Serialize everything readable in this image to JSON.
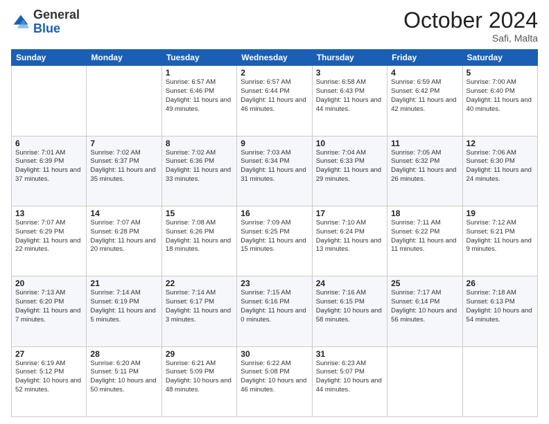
{
  "logo": {
    "general": "General",
    "blue": "Blue"
  },
  "header": {
    "month": "October 2024",
    "location": "Safi, Malta"
  },
  "days_of_week": [
    "Sunday",
    "Monday",
    "Tuesday",
    "Wednesday",
    "Thursday",
    "Friday",
    "Saturday"
  ],
  "weeks": [
    [
      {
        "day": "",
        "info": ""
      },
      {
        "day": "",
        "info": ""
      },
      {
        "day": "1",
        "info": "Sunrise: 6:57 AM\nSunset: 6:46 PM\nDaylight: 11 hours and 49 minutes."
      },
      {
        "day": "2",
        "info": "Sunrise: 6:57 AM\nSunset: 6:44 PM\nDaylight: 11 hours and 46 minutes."
      },
      {
        "day": "3",
        "info": "Sunrise: 6:58 AM\nSunset: 6:43 PM\nDaylight: 11 hours and 44 minutes."
      },
      {
        "day": "4",
        "info": "Sunrise: 6:59 AM\nSunset: 6:42 PM\nDaylight: 11 hours and 42 minutes."
      },
      {
        "day": "5",
        "info": "Sunrise: 7:00 AM\nSunset: 6:40 PM\nDaylight: 11 hours and 40 minutes."
      }
    ],
    [
      {
        "day": "6",
        "info": "Sunrise: 7:01 AM\nSunset: 6:39 PM\nDaylight: 11 hours and 37 minutes."
      },
      {
        "day": "7",
        "info": "Sunrise: 7:02 AM\nSunset: 6:37 PM\nDaylight: 11 hours and 35 minutes."
      },
      {
        "day": "8",
        "info": "Sunrise: 7:02 AM\nSunset: 6:36 PM\nDaylight: 11 hours and 33 minutes."
      },
      {
        "day": "9",
        "info": "Sunrise: 7:03 AM\nSunset: 6:34 PM\nDaylight: 11 hours and 31 minutes."
      },
      {
        "day": "10",
        "info": "Sunrise: 7:04 AM\nSunset: 6:33 PM\nDaylight: 11 hours and 29 minutes."
      },
      {
        "day": "11",
        "info": "Sunrise: 7:05 AM\nSunset: 6:32 PM\nDaylight: 11 hours and 26 minutes."
      },
      {
        "day": "12",
        "info": "Sunrise: 7:06 AM\nSunset: 6:30 PM\nDaylight: 11 hours and 24 minutes."
      }
    ],
    [
      {
        "day": "13",
        "info": "Sunrise: 7:07 AM\nSunset: 6:29 PM\nDaylight: 11 hours and 22 minutes."
      },
      {
        "day": "14",
        "info": "Sunrise: 7:07 AM\nSunset: 6:28 PM\nDaylight: 11 hours and 20 minutes."
      },
      {
        "day": "15",
        "info": "Sunrise: 7:08 AM\nSunset: 6:26 PM\nDaylight: 11 hours and 18 minutes."
      },
      {
        "day": "16",
        "info": "Sunrise: 7:09 AM\nSunset: 6:25 PM\nDaylight: 11 hours and 15 minutes."
      },
      {
        "day": "17",
        "info": "Sunrise: 7:10 AM\nSunset: 6:24 PM\nDaylight: 11 hours and 13 minutes."
      },
      {
        "day": "18",
        "info": "Sunrise: 7:11 AM\nSunset: 6:22 PM\nDaylight: 11 hours and 11 minutes."
      },
      {
        "day": "19",
        "info": "Sunrise: 7:12 AM\nSunset: 6:21 PM\nDaylight: 11 hours and 9 minutes."
      }
    ],
    [
      {
        "day": "20",
        "info": "Sunrise: 7:13 AM\nSunset: 6:20 PM\nDaylight: 11 hours and 7 minutes."
      },
      {
        "day": "21",
        "info": "Sunrise: 7:14 AM\nSunset: 6:19 PM\nDaylight: 11 hours and 5 minutes."
      },
      {
        "day": "22",
        "info": "Sunrise: 7:14 AM\nSunset: 6:17 PM\nDaylight: 11 hours and 3 minutes."
      },
      {
        "day": "23",
        "info": "Sunrise: 7:15 AM\nSunset: 6:16 PM\nDaylight: 11 hours and 0 minutes."
      },
      {
        "day": "24",
        "info": "Sunrise: 7:16 AM\nSunset: 6:15 PM\nDaylight: 10 hours and 58 minutes."
      },
      {
        "day": "25",
        "info": "Sunrise: 7:17 AM\nSunset: 6:14 PM\nDaylight: 10 hours and 56 minutes."
      },
      {
        "day": "26",
        "info": "Sunrise: 7:18 AM\nSunset: 6:13 PM\nDaylight: 10 hours and 54 minutes."
      }
    ],
    [
      {
        "day": "27",
        "info": "Sunrise: 6:19 AM\nSunset: 5:12 PM\nDaylight: 10 hours and 52 minutes."
      },
      {
        "day": "28",
        "info": "Sunrise: 6:20 AM\nSunset: 5:11 PM\nDaylight: 10 hours and 50 minutes."
      },
      {
        "day": "29",
        "info": "Sunrise: 6:21 AM\nSunset: 5:09 PM\nDaylight: 10 hours and 48 minutes."
      },
      {
        "day": "30",
        "info": "Sunrise: 6:22 AM\nSunset: 5:08 PM\nDaylight: 10 hours and 46 minutes."
      },
      {
        "day": "31",
        "info": "Sunrise: 6:23 AM\nSunset: 5:07 PM\nDaylight: 10 hours and 44 minutes."
      },
      {
        "day": "",
        "info": ""
      },
      {
        "day": "",
        "info": ""
      }
    ]
  ]
}
